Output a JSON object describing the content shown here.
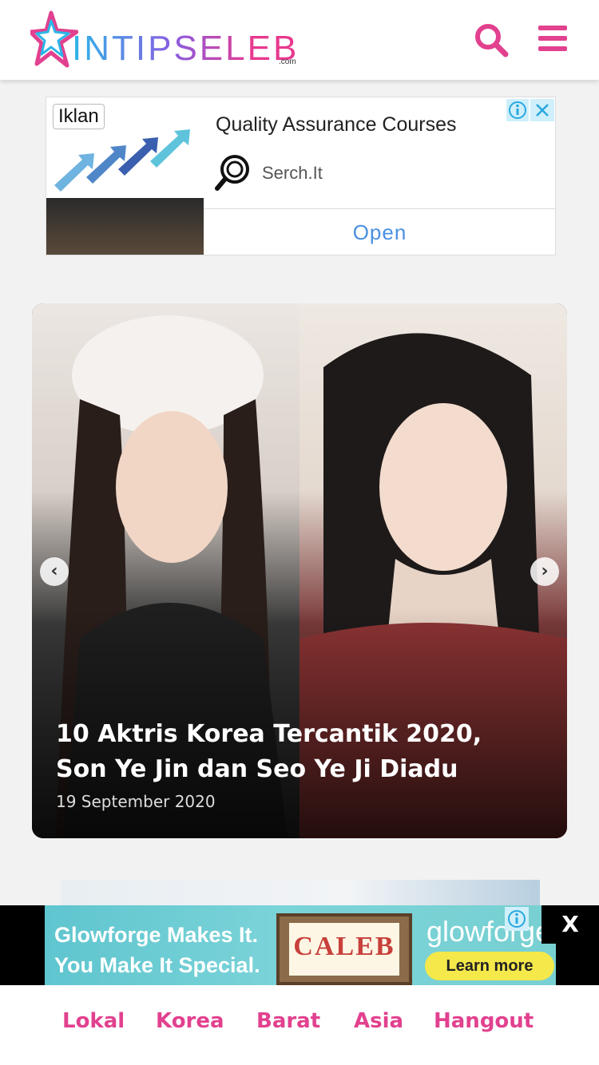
{
  "header": {
    "logo_text": "INTIPSELEB",
    "logo_suffix": ".com",
    "search_icon": "search-icon",
    "menu_icon": "hamburger-menu-icon",
    "accent_color": "#e2418f"
  },
  "top_ad": {
    "badge": "Iklan",
    "title": "Quality Assurance Courses",
    "advertiser": "Serch.It",
    "cta": "Open",
    "cta_color": "#4a90e2"
  },
  "slider": {
    "title": "10 Aktris Korea Tercantik 2020, Son Ye Jin dan Seo Ye Ji Diadu",
    "date": "19 September 2020",
    "prev_icon": "‹",
    "next_icon": "›"
  },
  "bottom_ad": {
    "headline": "Glowforge Makes It. You Make It Special.",
    "frame_text": "CALEB",
    "brand": "glowforge",
    "cta": "Learn more",
    "close_label": "X"
  },
  "nav": {
    "items": [
      "Lokal",
      "Korea",
      "Barat",
      "Asia",
      "Hangout"
    ]
  }
}
